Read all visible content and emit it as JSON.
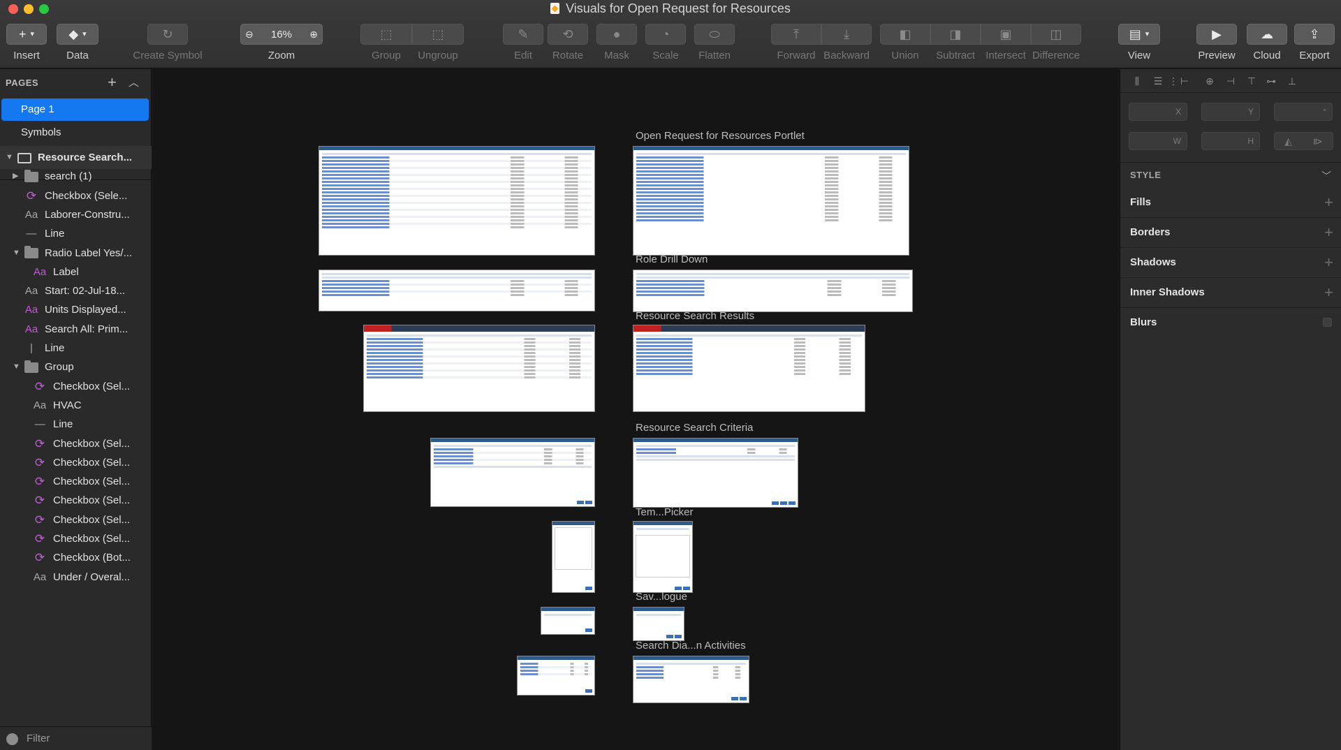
{
  "window": {
    "title": "Visuals for Open Request for Resources",
    "traffic_colors": [
      "#fc5f57",
      "#fdbc2e",
      "#28c840"
    ]
  },
  "toolbar": {
    "insert": "Insert",
    "data": "Data",
    "create_symbol": "Create Symbol",
    "zoom_value": "16%",
    "zoom": "Zoom",
    "group": "Group",
    "ungroup": "Ungroup",
    "edit": "Edit",
    "rotate": "Rotate",
    "mask": "Mask",
    "scale": "Scale",
    "flatten": "Flatten",
    "forward": "Forward",
    "backward": "Backward",
    "union": "Union",
    "subtract": "Subtract",
    "intersect": "Intersect",
    "difference": "Difference",
    "view": "View",
    "preview": "Preview",
    "cloud": "Cloud",
    "export": "Export"
  },
  "sidebar": {
    "pages_header": "PAGES",
    "pages": [
      {
        "label": "Page 1",
        "selected": true
      },
      {
        "label": "Symbols",
        "selected": false
      }
    ],
    "layers": [
      {
        "label": "Resource Search...",
        "icon": "artboard-icon",
        "root": true
      },
      {
        "label": "search (1)",
        "icon": "folder-icon"
      },
      {
        "label": "Checkbox (Sele...",
        "icon": "symbol-icon"
      },
      {
        "label": "Laborer-Constru...",
        "icon": "text-icon"
      },
      {
        "label": "Line",
        "icon": "line-icon"
      },
      {
        "label": "Radio Label Yes/...",
        "icon": "folder-icon"
      },
      {
        "label": "Label",
        "icon": "text-icon"
      },
      {
        "label": "Start: 02-Jul-18...",
        "icon": "text-icon"
      },
      {
        "label": "Units Displayed...",
        "icon": "text-icon"
      },
      {
        "label": "Search All: Prim...",
        "icon": "text-icon"
      },
      {
        "label": "Line",
        "icon": "line-icon"
      },
      {
        "label": "Group",
        "icon": "folder-icon"
      },
      {
        "label": "Checkbox (Sel...",
        "icon": "symbol-icon"
      },
      {
        "label": "HVAC",
        "icon": "text-icon"
      },
      {
        "label": "Line",
        "icon": "line-icon"
      },
      {
        "label": "Checkbox (Sel...",
        "icon": "symbol-icon"
      },
      {
        "label": "Checkbox (Sel...",
        "icon": "symbol-icon"
      },
      {
        "label": "Checkbox (Sel...",
        "icon": "symbol-icon"
      },
      {
        "label": "Checkbox (Sel...",
        "icon": "symbol-icon"
      },
      {
        "label": "Checkbox (Sel...",
        "icon": "symbol-icon"
      },
      {
        "label": "Checkbox (Sel...",
        "icon": "symbol-icon"
      },
      {
        "label": "Checkbox (Bot...",
        "icon": "symbol-icon"
      },
      {
        "label": "Under / Overal...",
        "icon": "text-icon"
      }
    ],
    "filter": "Filter"
  },
  "canvas": {
    "artboard_titles": {
      "portlet": "Open Request for Resources Portlet",
      "role_drill": "Role Drill Down",
      "search_results": "Resource Search Results",
      "search_criteria": "Resource Search Criteria",
      "template_picker": "Tem...Picker",
      "save_dialogue": "Sav...logue",
      "search_dialog": "Search Dia...n Activities"
    }
  },
  "inspector": {
    "fields": {
      "x": "X",
      "y": "Y",
      "rotation": "°",
      "w": "W",
      "h": "H"
    },
    "style_label": "STYLE",
    "sections": [
      "Fills",
      "Borders",
      "Shadows",
      "Inner Shadows",
      "Blurs"
    ]
  }
}
